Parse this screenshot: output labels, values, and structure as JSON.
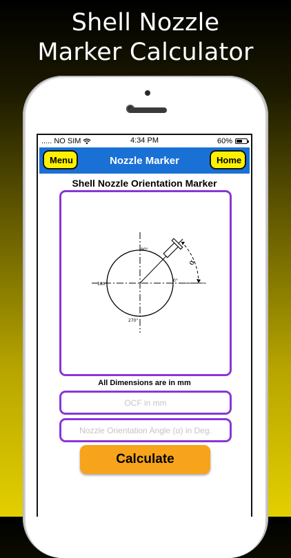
{
  "promo": {
    "title_line1": "Shell Nozzle",
    "title_line2": "Marker Calculator"
  },
  "status_bar": {
    "signal": "..... NO SIM",
    "time": "4:34 PM",
    "battery": "60%",
    "battery_level": 0.6
  },
  "navbar": {
    "title": "Nozzle Marker",
    "menu_label": "Menu",
    "home_label": "Home",
    "color": "#1971d6",
    "button_color": "#fff200"
  },
  "page": {
    "heading": "Shell Nozzle Orientation Marker",
    "dims_note": "All Dimensions are in mm",
    "accent_color": "#8a35d6"
  },
  "diagram": {
    "label_90": "90°",
    "label_180": "180°",
    "label_0": "0°",
    "label_270": "270°",
    "label_alpha": "α"
  },
  "form": {
    "ocf_placeholder": "OCF in mm",
    "angle_placeholder": "Nozzle Orientation Angle (α) in Deg.",
    "calculate_label": "Calculate",
    "calculate_color": "#f7a41c"
  }
}
